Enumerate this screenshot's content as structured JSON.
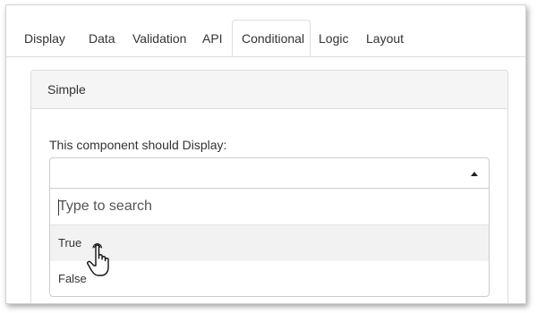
{
  "tabs": [
    {
      "label": "Display",
      "active": false
    },
    {
      "label": "Data",
      "active": false
    },
    {
      "label": "Validation",
      "active": false
    },
    {
      "label": "API",
      "active": false
    },
    {
      "label": "Conditional",
      "active": true
    },
    {
      "label": "Logic",
      "active": false
    },
    {
      "label": "Layout",
      "active": false
    }
  ],
  "panel": {
    "title": "Simple"
  },
  "display_field": {
    "label": "This component should Display:",
    "selected_value": "",
    "search_placeholder": "Type to search",
    "options": [
      "True",
      "False"
    ],
    "highlighted_option": "True"
  },
  "icons": {
    "dropdown_caret": "caret-up-icon",
    "pointer": "hand-pointer-icon"
  },
  "colors": {
    "panel_heading_bg": "#f5f5f5",
    "border": "#dddddd",
    "highlight_bg": "#f2f2f2",
    "text": "#333333"
  }
}
